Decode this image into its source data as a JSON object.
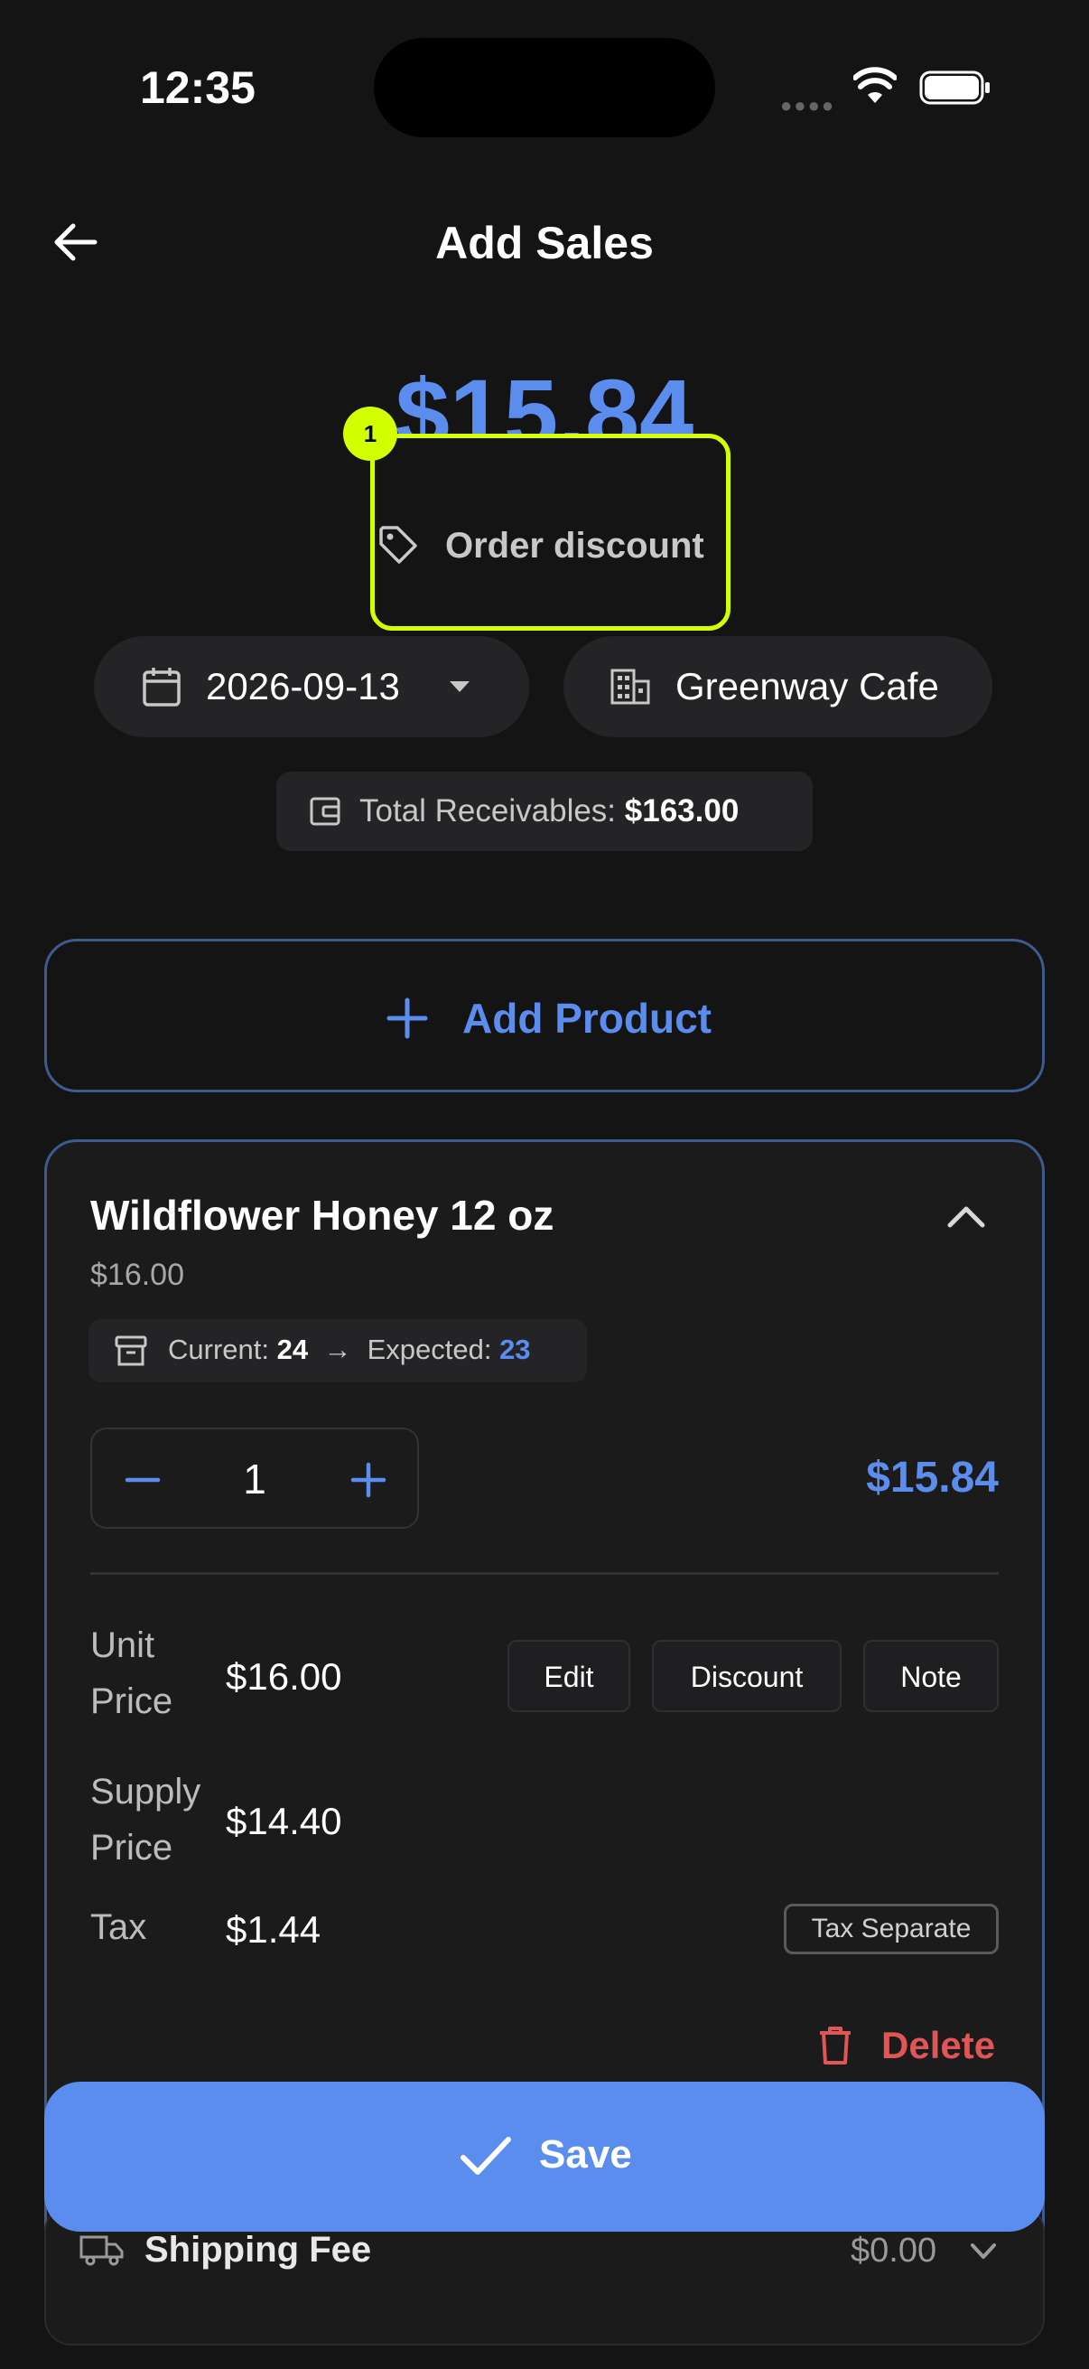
{
  "status_bar": {
    "time": "12:35"
  },
  "header": {
    "title": "Add Sales"
  },
  "summary": {
    "total": "$15.84"
  },
  "order_discount": {
    "badge": "1",
    "label": "Order discount"
  },
  "filters": {
    "date": "2026-09-13",
    "customer": "Greenway Cafe"
  },
  "receivables": {
    "label": "Total Receivables:",
    "value": "$163.00"
  },
  "add_product": {
    "label": "Add Product"
  },
  "product": {
    "name": "Wildflower Honey 12 oz",
    "price": "$16.00",
    "stock": {
      "current_label": "Current:",
      "current": "24",
      "arrow": "→",
      "expected_label": "Expected:",
      "expected": "23"
    },
    "quantity": "1",
    "line_total": "$15.84",
    "unit_price": {
      "label_1": "Unit",
      "label_2": "Price",
      "value": "$16.00"
    },
    "supply_price": {
      "label_1": "Supply",
      "label_2": "Price",
      "value": "$14.40"
    },
    "tax": {
      "label": "Tax",
      "value": "$1.44",
      "tag": "Tax Separate"
    },
    "buttons": {
      "edit": "Edit",
      "discount": "Discount",
      "note": "Note"
    },
    "delete": "Delete"
  },
  "shipping": {
    "label": "Shipping Fee",
    "value": "$0.00"
  },
  "save": {
    "label": "Save"
  },
  "colors": {
    "accent": "#5b8def",
    "highlight": "#d4ff00",
    "danger": "#e05555",
    "background": "#141415"
  }
}
